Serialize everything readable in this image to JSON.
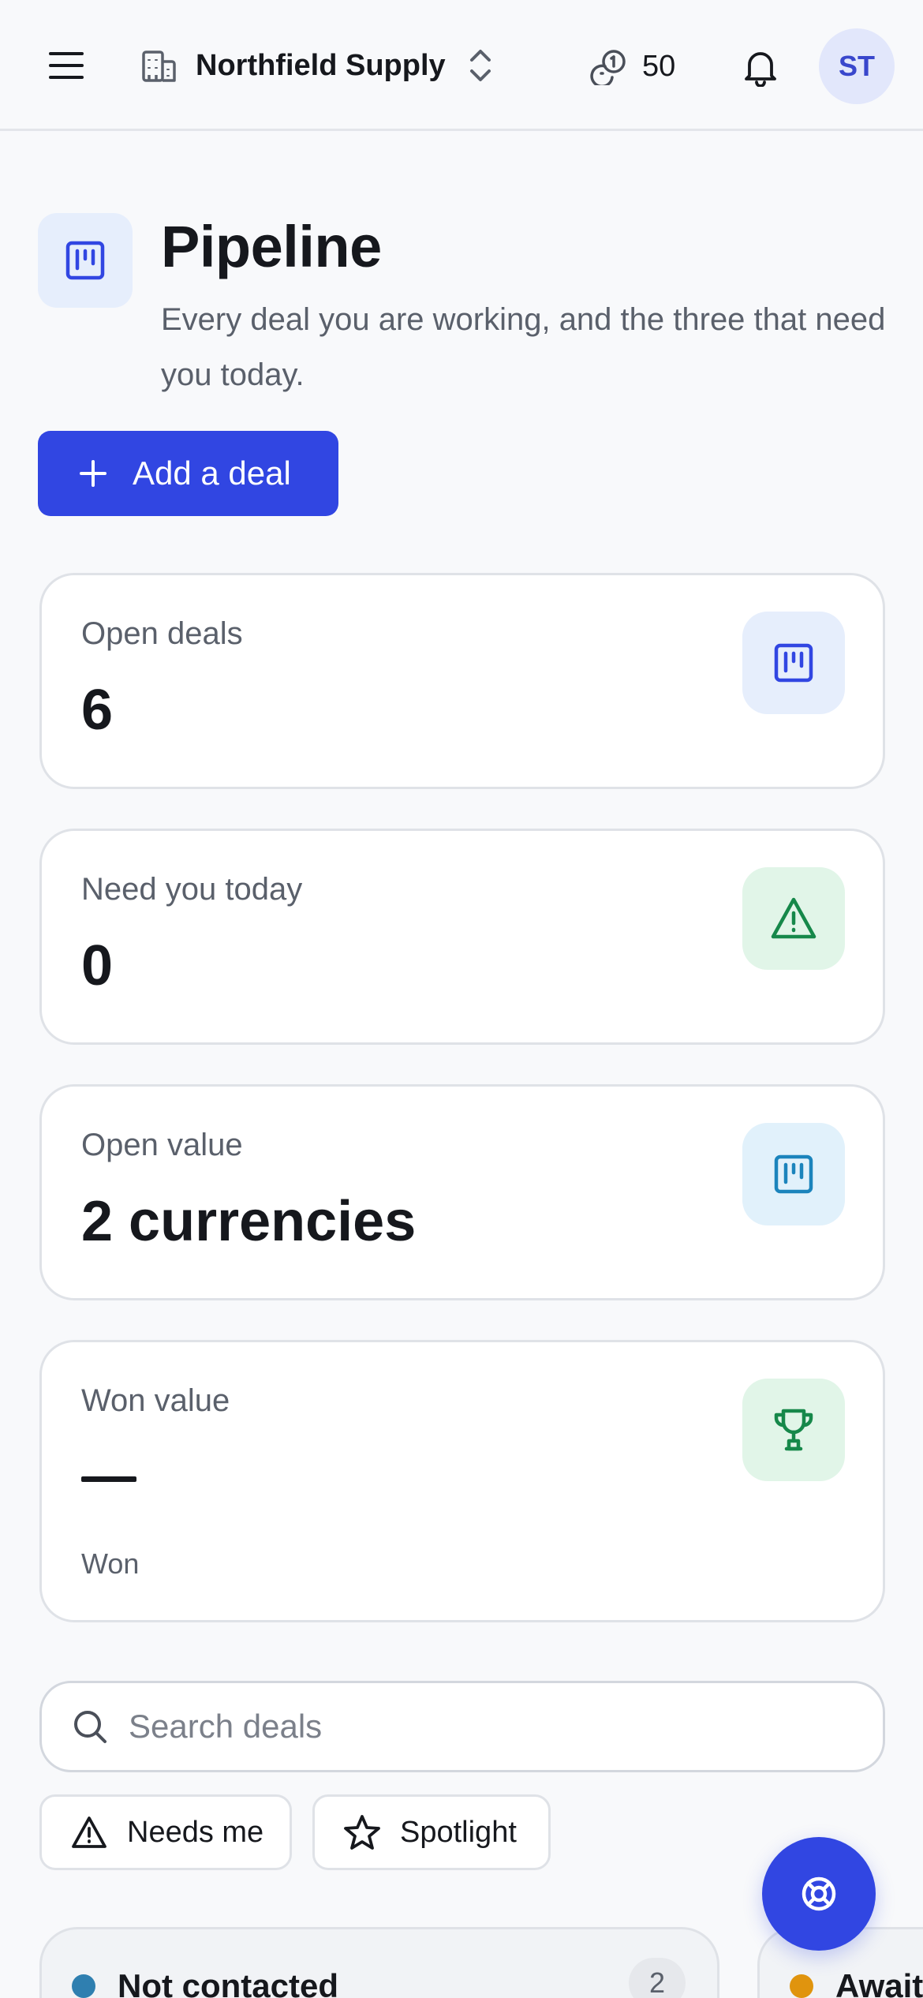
{
  "header": {
    "org_name": "Northfield Supply",
    "credits": "50",
    "avatar_initials": "ST"
  },
  "page": {
    "title": "Pipeline",
    "subtitle": "Every deal you are working, and the three that need you today.",
    "add_button_label": "Add a deal"
  },
  "stats": [
    {
      "label": "Open deals",
      "value": "6",
      "icon": "kanban-icon",
      "icon_bg": "#e6eefc",
      "icon_color": "#3146e2"
    },
    {
      "label": "Need you today",
      "value": "0",
      "icon": "warning-icon",
      "icon_bg": "#e1f5e8",
      "icon_color": "#16884a"
    },
    {
      "label": "Open value",
      "value": "2 currencies",
      "icon": "kanban-icon",
      "icon_bg": "#e1f1fb",
      "icon_color": "#1b84bc"
    },
    {
      "label": "Won value",
      "value": "—",
      "note": "Won",
      "icon": "trophy-icon",
      "icon_bg": "#e1f5e8",
      "icon_color": "#16884a"
    }
  ],
  "search": {
    "placeholder": "Search deals"
  },
  "filters": [
    {
      "label": "Needs me",
      "icon": "warning-icon"
    },
    {
      "label": "Spotlight",
      "icon": "star-icon"
    }
  ],
  "columns": [
    {
      "title": "Not contacted",
      "count": "2",
      "color": "#2f7fb0"
    },
    {
      "title": "Awaiti",
      "color": "#e0940e"
    }
  ],
  "colors": {
    "accent": "#3146e2",
    "background": "#f8f9fb"
  }
}
